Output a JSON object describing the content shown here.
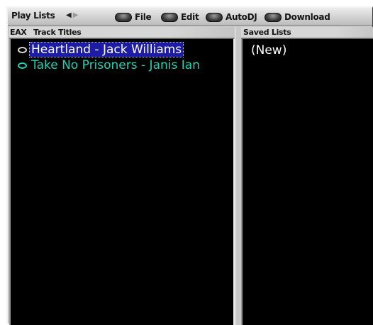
{
  "toolbar": {
    "title": "Play Lists",
    "menus": [
      {
        "label": "File",
        "icon": "pill-button-icon"
      },
      {
        "label": "Edit",
        "icon": "pill-button-icon"
      },
      {
        "label": "AutoDJ",
        "icon": "pill-button-icon"
      },
      {
        "label": "Download",
        "icon": "pill-button-icon"
      }
    ],
    "nav_left_icon": "◀",
    "nav_right_icon": "▶"
  },
  "tracks_panel": {
    "header_eax": "EAX",
    "header_title": "Track Titles",
    "tracks": [
      {
        "title": "Heartland - Jack Williams",
        "selected": true,
        "color": "#ffffff"
      },
      {
        "title": "Take No Prisoners - Janis Ian",
        "selected": false,
        "color": "#19d4b8"
      }
    ]
  },
  "saved_panel": {
    "header": "Saved Lists",
    "items": [
      "(New)"
    ]
  },
  "colors": {
    "list_bg": "#000000",
    "selection_bg": "#1c1ca6",
    "frame": "#c8c8c8"
  }
}
